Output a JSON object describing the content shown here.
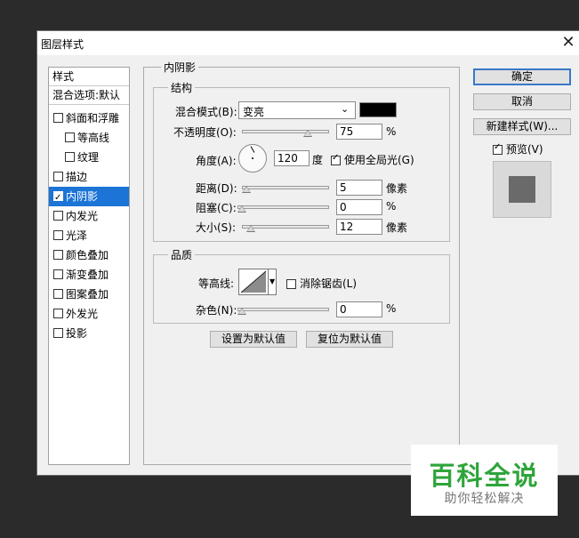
{
  "window": {
    "title": "图层样式"
  },
  "style_list": {
    "header": "样式",
    "blend_options": "混合选项:默认",
    "items": [
      {
        "label": "斜面和浮雕",
        "checked": false
      },
      {
        "label": "等高线",
        "checked": false
      },
      {
        "label": "纹理",
        "checked": false
      },
      {
        "label": "描边",
        "checked": false
      },
      {
        "label": "内阴影",
        "checked": true,
        "selected": true
      },
      {
        "label": "内发光",
        "checked": false
      },
      {
        "label": "光泽",
        "checked": false
      },
      {
        "label": "颜色叠加",
        "checked": false
      },
      {
        "label": "渐变叠加",
        "checked": false
      },
      {
        "label": "图案叠加",
        "checked": false
      },
      {
        "label": "外发光",
        "checked": false
      },
      {
        "label": "投影",
        "checked": false
      }
    ]
  },
  "panel": {
    "title": "内阴影",
    "structure": {
      "title": "结构",
      "blend_mode_label": "混合模式(B):",
      "blend_mode_value": "变亮",
      "color": "#000000",
      "opacity_label": "不透明度(O):",
      "opacity_value": "75",
      "opacity_unit": "%",
      "angle_label": "角度(A):",
      "angle_value": "120",
      "angle_unit": "度",
      "global_light_label": "使用全局光(G)",
      "global_light_checked": true,
      "distance_label": "距离(D):",
      "distance_value": "5",
      "distance_unit": "像素",
      "choke_label": "阻塞(C):",
      "choke_value": "0",
      "choke_unit": "%",
      "size_label": "大小(S):",
      "size_value": "12",
      "size_unit": "像素"
    },
    "quality": {
      "title": "品质",
      "contour_label": "等高线:",
      "antialias_label": "消除锯齿(L)",
      "antialias_checked": false,
      "noise_label": "杂色(N):",
      "noise_value": "0",
      "noise_unit": "%"
    },
    "make_default": "设置为默认值",
    "reset_default": "复位为默认值"
  },
  "buttons": {
    "ok": "确定",
    "cancel": "取消",
    "new_style": "新建样式(W)...",
    "preview_label": "预览(V)",
    "preview_checked": true
  },
  "watermark": {
    "title": "百科全说",
    "subtitle": "助你轻松解决"
  }
}
